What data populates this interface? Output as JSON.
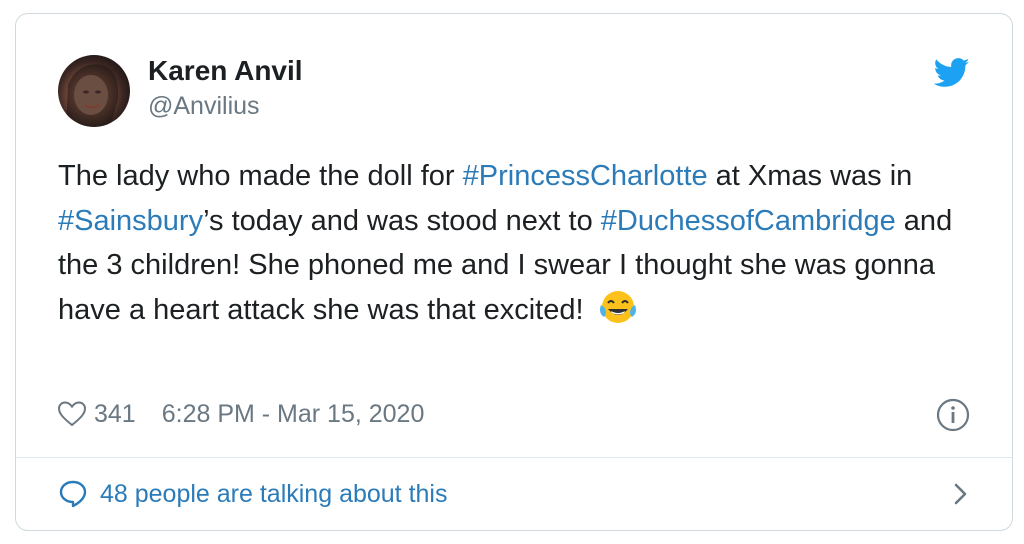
{
  "tweet": {
    "author": {
      "display_name": "Karen Anvil",
      "handle": "@Anvilius"
    },
    "text_segments": [
      {
        "type": "text",
        "value": "The lady who made the doll for "
      },
      {
        "type": "hashtag",
        "value": "#PrincessCharlotte"
      },
      {
        "type": "text",
        "value": " at Xmas was in "
      },
      {
        "type": "hashtag",
        "value": "#Sainsbury"
      },
      {
        "type": "text",
        "value": "’s today and was stood next to "
      },
      {
        "type": "hashtag",
        "value": "#DuchessofCambridge"
      },
      {
        "type": "text",
        "value": " and the 3 children! She phoned me and I swear I thought she was gonna have a heart attack she was that excited! "
      }
    ],
    "emoji": "face-with-tears-of-joy",
    "likes": "341",
    "timestamp": "6:28 PM - Mar 15, 2020",
    "conversation_label": "48 people are talking about this"
  },
  "icons": {
    "brand": "twitter-bird-icon",
    "like": "heart-icon",
    "info": "info-icon",
    "conversation": "speech-bubble-icon",
    "chevron": "chevron-right-icon"
  },
  "colors": {
    "link": "#2b7bb9",
    "brand": "#1da1f2",
    "muted": "#697882",
    "text": "#1c2022",
    "border": "#cfd9de"
  }
}
